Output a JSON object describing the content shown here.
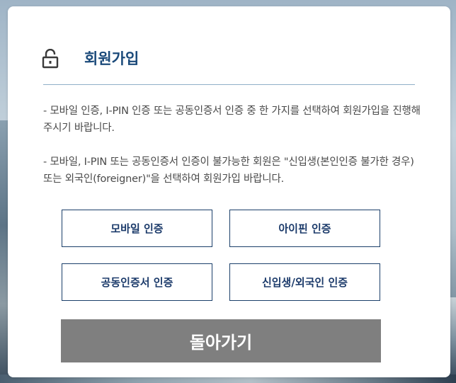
{
  "dialog": {
    "title": "회원가입",
    "lock_icon": "unlock-icon",
    "description_1": "- 모바일 인증, I-PIN 인증 또는 공동인증서 인증 중 한 가지를 선택하여 회원가입을 진행해주시기 바랍니다.",
    "description_2": "- 모바일, I-PIN 또는 공동인증서 인증이 불가능한 회원은 \"신입생(본인인증 불가한 경우) 또는 외국인(foreigner)\"을 선택하여 회원가입 바랍니다.",
    "buttons": {
      "mobile": "모바일 인증",
      "ipin": "아이핀 인증",
      "certificate": "공동인증서 인증",
      "freshman_foreigner": "신입생/외국인 인증"
    },
    "back_label": "돌아가기"
  },
  "colors": {
    "title": "#1b4a7a",
    "button_border": "#1b3f6a",
    "back_button_bg": "#7f7f7f",
    "divider": "#8fb0c8"
  }
}
